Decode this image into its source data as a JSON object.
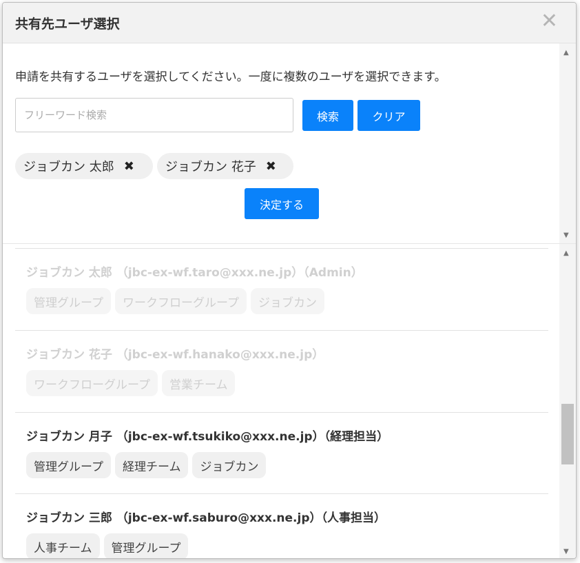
{
  "modal": {
    "title": "共有先ユーザ選択",
    "close": "✕"
  },
  "top": {
    "instruction": "申請を共有するユーザを選択してください。一度に複数のユーザを選択できます。",
    "search": {
      "placeholder": "フリーワード検索",
      "value": ""
    },
    "search_label": "検索",
    "clear_label": "クリア",
    "selected": [
      {
        "name": "ジョブカン 太郎",
        "remove": "✖"
      },
      {
        "name": "ジョブカン 花子",
        "remove": "✖"
      }
    ],
    "decide_label": "決定する"
  },
  "users": [
    {
      "name": "ジョブカン 太郎 （jbc-ex-wf.taro@xxx.ne.jp）（Admin）",
      "tags": [
        "管理グループ",
        "ワークフローグループ",
        "ジョブカン"
      ],
      "selected": true
    },
    {
      "name": "ジョブカン 花子 （jbc-ex-wf.hanako@xxx.ne.jp）",
      "tags": [
        "ワークフローグループ",
        "営業チーム"
      ],
      "selected": true
    },
    {
      "name": "ジョブカン 月子 （jbc-ex-wf.tsukiko@xxx.ne.jp）（経理担当）",
      "tags": [
        "管理グループ",
        "経理チーム",
        "ジョブカン"
      ],
      "selected": false
    },
    {
      "name": "ジョブカン 三郎 （jbc-ex-wf.saburo@xxx.ne.jp）（人事担当）",
      "tags": [
        "人事チーム",
        "管理グループ"
      ],
      "selected": false
    }
  ],
  "scroll": {
    "up": "▲",
    "down": "▼"
  },
  "colors": {
    "primary": "#0a82fa",
    "chip_bg": "#f0f0f0",
    "disabled_text": "#d0d0d0"
  }
}
